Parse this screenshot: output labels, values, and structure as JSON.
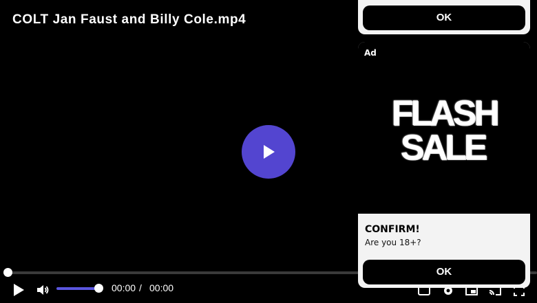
{
  "video": {
    "title": "COLT Jan Faust and Billy Cole.mp4",
    "current_time": "00:00",
    "time_separator": "/",
    "duration": "00:00",
    "progress": 0,
    "volume": 1.0
  },
  "icons": {
    "big_play": "play-icon",
    "play": "play-icon",
    "volume": "volume-icon",
    "right": [
      "captions-icon",
      "settings-icon",
      "miniplayer-icon",
      "cast-icon",
      "fullscreen-icon"
    ]
  },
  "colors": {
    "accent": "#5345d0",
    "volume_fill": "#5b57e0",
    "card_bg": "#f3f3f3",
    "button_bg": "#000000"
  },
  "ad_top": {
    "ok_label": "OK"
  },
  "ad": {
    "label": "Ad",
    "image_line1": "FLASH",
    "image_line2": "SALE",
    "confirm_title": "CONFIRM!",
    "confirm_text": "Are you 18+?",
    "ok_label": "OK"
  }
}
